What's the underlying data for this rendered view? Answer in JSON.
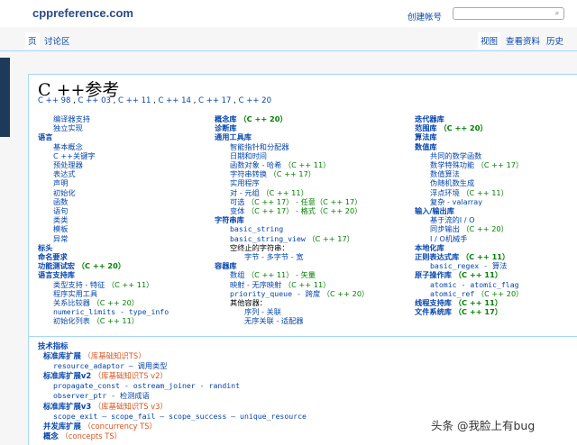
{
  "header": {
    "logo": "cppreference.com",
    "create_account": "创建帐号",
    "search_placeholder": "",
    "search_icon": "search-icon"
  },
  "tabs": {
    "page": "页",
    "discussion": "讨论区",
    "view": "视图",
    "view_source": "查看资料",
    "history": "历史"
  },
  "title": "C ++参考",
  "versions": [
    "C ++ 98",
    "C ++ 03",
    "C ++ 11",
    "C ++ 14",
    "C ++ 17",
    "C ++ 20"
  ],
  "col1": [
    {
      "t": "i1",
      "text": "编译器支持"
    },
    {
      "t": "i1",
      "text": "独立实现"
    },
    {
      "t": "sec",
      "text": "语言"
    },
    {
      "t": "i1",
      "text": "基本概念"
    },
    {
      "t": "i1",
      "text": "C ++关键字"
    },
    {
      "t": "i1",
      "text": "预处理器"
    },
    {
      "t": "i1",
      "text": "表达式"
    },
    {
      "t": "i1",
      "text": "声明"
    },
    {
      "t": "i1",
      "text": "初始化"
    },
    {
      "t": "i1",
      "text": "函数"
    },
    {
      "t": "i1",
      "text": "语句"
    },
    {
      "t": "i1",
      "text": "类类"
    },
    {
      "t": "i1",
      "text": "模板"
    },
    {
      "t": "i1",
      "text": "异常"
    },
    {
      "t": "sec",
      "text": "标头"
    },
    {
      "t": "sec",
      "text": "命名要求"
    },
    {
      "t": "sec",
      "text": "功能测试宏",
      "ver": "（C ++ 20）"
    },
    {
      "t": "sec",
      "text": "语言支持库"
    },
    {
      "t": "i1",
      "text": "类型支持 - 特征",
      "ver": "（C ++ 11）"
    },
    {
      "t": "i1",
      "text": "程序实用工具"
    },
    {
      "t": "i1",
      "text": "关系比较器",
      "ver": "（C ++ 20）"
    },
    {
      "t": "i1m",
      "text": "numeric_limits - type_info"
    },
    {
      "t": "i1",
      "text": "初始化列表",
      "ver": "（C ++ 11）"
    }
  ],
  "col2": [
    {
      "t": "sec",
      "text": "概念库",
      "ver": "（C ++ 20）"
    },
    {
      "t": "sec",
      "text": "诊断库"
    },
    {
      "t": "sec",
      "text": "通用工具库"
    },
    {
      "t": "i1",
      "text": "智能指针和分配器"
    },
    {
      "t": "i1",
      "text": "日期和时间"
    },
    {
      "t": "i1",
      "text": "函数对象 - 哈希",
      "ver": "（C ++ 11）"
    },
    {
      "t": "i1",
      "text": "字符串转换",
      "ver": "（C ++ 17）"
    },
    {
      "t": "i1",
      "text": "实用程序"
    },
    {
      "t": "i1",
      "text": "对 - 元组",
      "ver": "（C ++ 11）"
    },
    {
      "t": "i1",
      "text": "可选",
      "ver": "（C ++ 17） - 任意（C ++ 17）"
    },
    {
      "t": "i1",
      "text": "变体",
      "ver": "（C ++ 17） - 格式（C ++ 20）"
    },
    {
      "t": "sec",
      "text": "字符串库"
    },
    {
      "t": "i1m",
      "text": "basic_string"
    },
    {
      "t": "i1m",
      "text": "basic_string_view",
      "ver": "（C ++ 17）"
    },
    {
      "t": "i1p",
      "text": "空终止的字符串："
    },
    {
      "t": "i2",
      "text": "字节 - 多字节 - 宽"
    },
    {
      "t": "sec",
      "text": "容器库"
    },
    {
      "t": "i1",
      "text": "数组",
      "ver": "（C ++ 11） - 矢量"
    },
    {
      "t": "i1",
      "text": "映射 - 无序映射",
      "ver": "（C ++ 11）"
    },
    {
      "t": "i1m",
      "text": "priority_queue - 跨度",
      "ver": "（C ++ 20）"
    },
    {
      "t": "i1p",
      "text": "其他容器："
    },
    {
      "t": "i2",
      "text": "序列 - 关联"
    },
    {
      "t": "i2",
      "text": "无序关联 - 适配器"
    }
  ],
  "col3": [
    {
      "t": "sec",
      "text": "迭代器库"
    },
    {
      "t": "sec",
      "text": "范围库",
      "ver": "（C ++ 20）"
    },
    {
      "t": "sec",
      "text": "算法库"
    },
    {
      "t": "sec",
      "text": "数值库"
    },
    {
      "t": "i1",
      "text": "共同的数学函数"
    },
    {
      "t": "i1",
      "text": "数学特殊功能",
      "ver": "（C ++ 17）"
    },
    {
      "t": "i1",
      "text": "数值算法"
    },
    {
      "t": "i1",
      "text": "伪随机数生成"
    },
    {
      "t": "i1",
      "text": "浮点环境",
      "ver": "（C ++ 11）"
    },
    {
      "t": "i1",
      "text": "复杂 - valarray"
    },
    {
      "t": "sec",
      "text": "输入/输出库"
    },
    {
      "t": "i1",
      "text": "基于流的I / O"
    },
    {
      "t": "i1",
      "text": "同步输出",
      "ver": "（C ++ 20）"
    },
    {
      "t": "i1",
      "text": "I / O机械手"
    },
    {
      "t": "sec",
      "text": "本地化库"
    },
    {
      "t": "sec",
      "text": "正则表达式库",
      "ver": "（C ++ 11）"
    },
    {
      "t": "i1m",
      "text": "basic_regex - 算法"
    },
    {
      "t": "sec",
      "text": "原子操作库",
      "ver": "（C ++ 11）"
    },
    {
      "t": "i1m",
      "text": "atomic - atomic_flag"
    },
    {
      "t": "i1m",
      "text": "atomic_ref",
      "ver": "（C ++ 20）"
    },
    {
      "t": "sec",
      "text": "线程支持库",
      "ver": "（C ++ 11）"
    },
    {
      "t": "sec",
      "text": "文件系统库",
      "ver": "（C ++ 17）"
    }
  ],
  "bottom": [
    {
      "t": "sec",
      "text": "技术指标"
    },
    {
      "t": "sub",
      "text": "标准库扩展",
      "ts": "（库基础知识TS）"
    },
    {
      "t": "m",
      "text": "resource_adaptor — 调用类型"
    },
    {
      "t": "sub",
      "text": "标准库扩展v2",
      "ts": "（库基础知识TS v2）"
    },
    {
      "t": "m",
      "text": "propagate_const - ostream_joiner - randint"
    },
    {
      "t": "m",
      "text": "observer_ptr - 检测成语"
    },
    {
      "t": "sub",
      "text": "标准库扩展v3",
      "ts": "（库基础知识TS v3）"
    },
    {
      "t": "m",
      "text": "scope_exit — scope_fail — scope_success — unique_resource"
    },
    {
      "t": "sub",
      "text": "并发库扩展",
      "ts": "（concurrency TS）"
    },
    {
      "t": "sub",
      "text": "概念",
      "ts": "（concepts TS）"
    }
  ],
  "watermark": "头条 @我脸上有bug"
}
